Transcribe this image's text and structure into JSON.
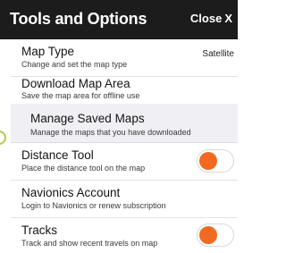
{
  "header": {
    "title": "Tools and Options",
    "close_label": "Close",
    "close_glyph": "X"
  },
  "items": [
    {
      "title": "Map Type",
      "subtitle": "Change and set the map type",
      "value": "Satellite"
    },
    {
      "title": "Download Map Area",
      "subtitle": "Save the map area for offline use"
    },
    {
      "title": "Manage Saved Maps",
      "subtitle": "Manage the maps that you have downloaded"
    },
    {
      "title": "Distance Tool",
      "subtitle": "Place the distance tool on the map",
      "toggle_on": true
    },
    {
      "title": "Navionics Account",
      "subtitle": "Login to Navionics or renew subscription"
    },
    {
      "title": "Tracks",
      "subtitle": "Track and show recent travels on map",
      "toggle_on": true
    }
  ],
  "colors": {
    "header_bg": "#1c1c1c",
    "toggle_accent": "#f26a21",
    "submenu_bg": "#f0f0f4"
  }
}
